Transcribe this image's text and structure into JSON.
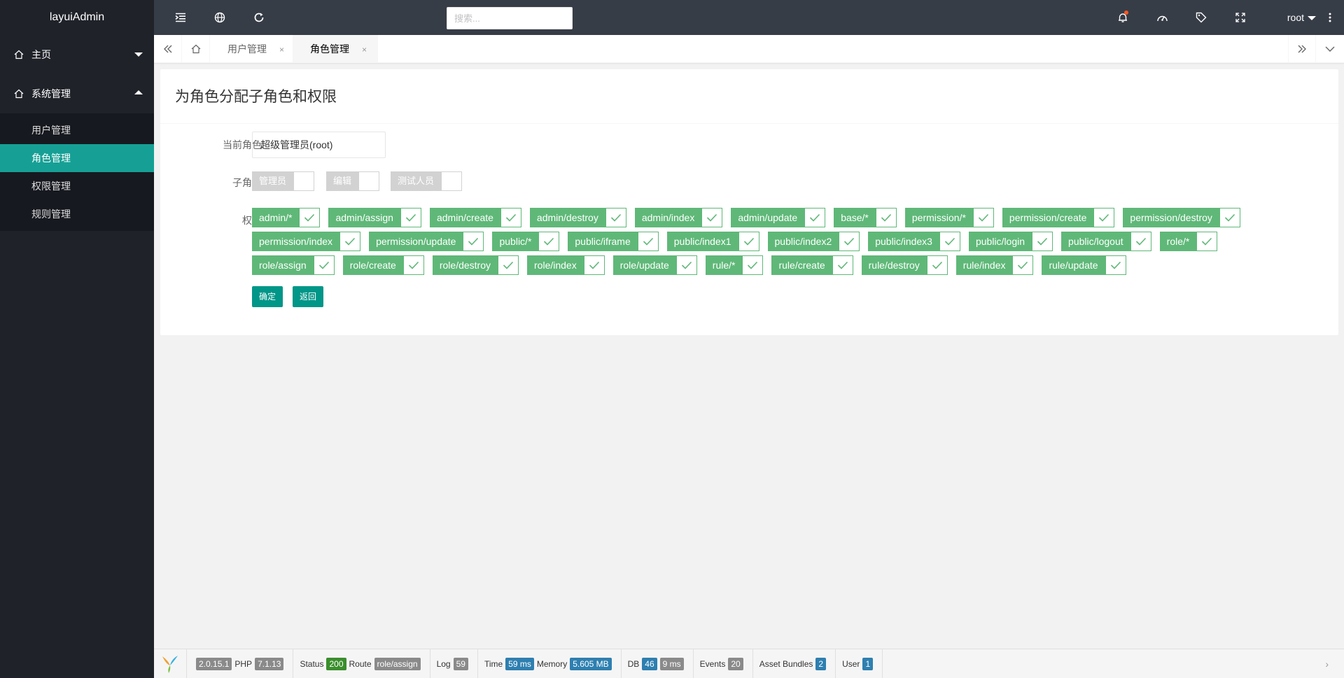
{
  "app": {
    "name": "layuiAdmin"
  },
  "sidebar": {
    "groups": [
      {
        "label": "主页",
        "expanded": false
      },
      {
        "label": "系统管理",
        "expanded": true
      }
    ],
    "sub_items": [
      {
        "label": "用户管理",
        "active": false
      },
      {
        "label": "角色管理",
        "active": true
      },
      {
        "label": "权限管理",
        "active": false
      },
      {
        "label": "规则管理",
        "active": false
      }
    ]
  },
  "header": {
    "search_placeholder": "搜索...",
    "user": "root"
  },
  "tabs": [
    {
      "label": "用户管理",
      "close": "×"
    },
    {
      "label": "角色管理",
      "close": "×"
    }
  ],
  "form": {
    "title": "为角色分配子角色和权限",
    "current_role_label": "当前角色",
    "current_role_value": "超级管理员(root)",
    "sub_role_label": "子角色",
    "sub_roles": [
      "管理员",
      "编辑",
      "测试人员"
    ],
    "permissions_label": "权限",
    "permissions": [
      "admin/*",
      "admin/assign",
      "admin/create",
      "admin/destroy",
      "admin/index",
      "admin/update",
      "base/*",
      "permission/*",
      "permission/create",
      "permission/destroy",
      "permission/index",
      "permission/update",
      "public/*",
      "public/iframe",
      "public/index1",
      "public/index2",
      "public/index3",
      "public/login",
      "public/logout",
      "role/*",
      "role/assign",
      "role/create",
      "role/destroy",
      "role/index",
      "role/update",
      "rule/*",
      "rule/create",
      "rule/destroy",
      "rule/index",
      "rule/update"
    ],
    "confirm_label": "确定",
    "back_label": "返回"
  },
  "debug": {
    "yii_version": "2.0.15.1",
    "php_label": "PHP",
    "php_version": "7.1.13",
    "status_label": "Status",
    "status_value": "200",
    "route_label": "Route",
    "route_value": "role/assign",
    "log_label": "Log",
    "log_value": "59",
    "time_label": "Time",
    "time_value": "59 ms",
    "memory_label": "Memory",
    "memory_value": "5.605 MB",
    "db_label": "DB",
    "db_queries": "46",
    "db_time": "9 ms",
    "events_label": "Events",
    "events_value": "20",
    "bundles_label": "Asset Bundles",
    "bundles_value": "2",
    "user_label": "User",
    "user_value": "1",
    "arrow": "›"
  },
  "colors": {
    "sidebar_bg": "#20222a",
    "header_bg": "#373d47",
    "accent": "#16a095",
    "permission_green": "#5fb878",
    "button": "#009688"
  }
}
